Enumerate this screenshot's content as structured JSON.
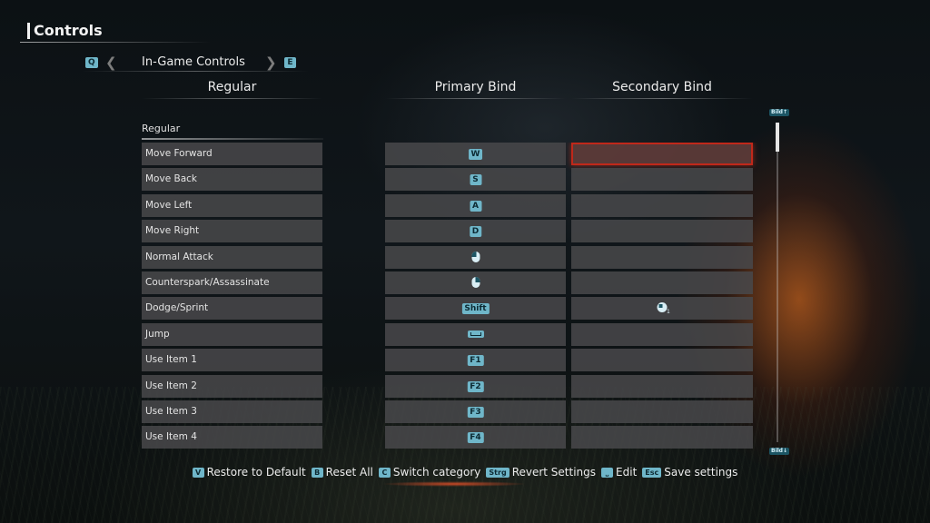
{
  "page": {
    "title": "Controls"
  },
  "category_nav": {
    "prev_key": "Q",
    "next_key": "E",
    "prev_arrow": "❮",
    "next_arrow": "❯",
    "label": "In-Game Controls"
  },
  "columns": {
    "action": "Regular",
    "primary": "Primary Bind",
    "secondary": "Secondary Bind"
  },
  "section_label": "Regular",
  "bindings": [
    {
      "action": "Move Forward",
      "primary": "W",
      "primary_icon": "",
      "secondary": "",
      "secondary_icon": "",
      "selected": true
    },
    {
      "action": "Move Back",
      "primary": "S",
      "primary_icon": "",
      "secondary": "",
      "secondary_icon": "",
      "selected": false
    },
    {
      "action": "Move Left",
      "primary": "A",
      "primary_icon": "",
      "secondary": "",
      "secondary_icon": "",
      "selected": false
    },
    {
      "action": "Move Right",
      "primary": "D",
      "primary_icon": "",
      "secondary": "",
      "secondary_icon": "",
      "selected": false
    },
    {
      "action": "Normal Attack",
      "primary": "",
      "primary_icon": "mouse-left-icon",
      "secondary": "",
      "secondary_icon": "",
      "selected": false
    },
    {
      "action": "Counterspark/Assassinate",
      "primary": "",
      "primary_icon": "mouse-right-icon",
      "secondary": "",
      "secondary_icon": "",
      "selected": false
    },
    {
      "action": "Dodge/Sprint",
      "primary": "Shift",
      "primary_icon": "",
      "secondary": "",
      "secondary_icon": "mouse-side-button-icon",
      "secondary_sub": "1",
      "selected": false
    },
    {
      "action": "Jump",
      "primary": "",
      "primary_icon": "spacebar-icon",
      "secondary": "",
      "secondary_icon": "",
      "selected": false
    },
    {
      "action": "Use Item 1",
      "primary": "F1",
      "primary_icon": "",
      "secondary": "",
      "secondary_icon": "",
      "selected": false
    },
    {
      "action": "Use Item 2",
      "primary": "F2",
      "primary_icon": "",
      "secondary": "",
      "secondary_icon": "",
      "selected": false
    },
    {
      "action": "Use Item 3",
      "primary": "F3",
      "primary_icon": "",
      "secondary": "",
      "secondary_icon": "",
      "selected": false
    },
    {
      "action": "Use Item 4",
      "primary": "F4",
      "primary_icon": "",
      "secondary": "",
      "secondary_icon": "",
      "selected": false
    }
  ],
  "scrollbar": {
    "top_key": "Bild↑",
    "bottom_key": "Bild↓"
  },
  "footer_hints": [
    {
      "key": "V",
      "label": "Restore to Default"
    },
    {
      "key": "B",
      "label": "Reset All"
    },
    {
      "key": "C",
      "label": "Switch category"
    },
    {
      "key": "Strg",
      "label": "Revert Settings"
    },
    {
      "key": "⎵",
      "label": "Edit"
    },
    {
      "key": "Esc",
      "label": "Save settings"
    }
  ],
  "colors": {
    "key_badge": "#6fb6c9",
    "selected_border": "#c0281a",
    "row_bg": "#48484a"
  }
}
